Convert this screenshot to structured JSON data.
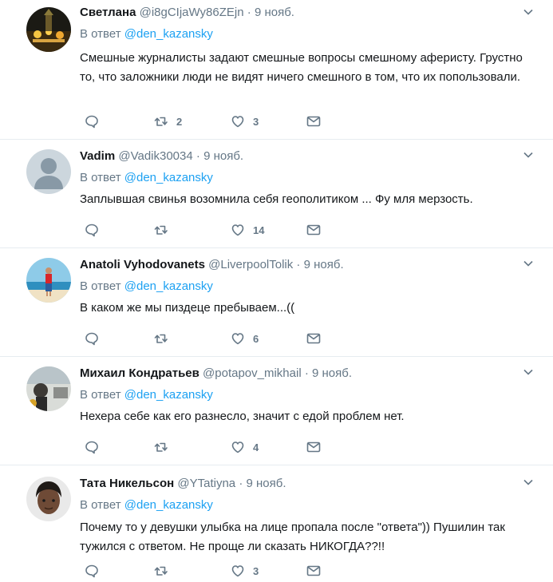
{
  "reply_prefix": "В ответ",
  "tweets": [
    {
      "name": "Светлана",
      "handle": "@i8gCIjaWy86ZEjn",
      "dot": "·",
      "time": "9 нояб.",
      "reply_to": "@den_kazansky",
      "text": "Смешные журналисты задают смешные вопросы смешному аферисту. Грустно то, что заложники люди не видят ничего смешного в том, что их попользовали.",
      "retweets": "2",
      "likes": "3"
    },
    {
      "name": "Vadim",
      "handle": "@Vadik30034",
      "dot": "·",
      "time": "9 нояб.",
      "reply_to": "@den_kazansky",
      "text": "Заплывшая свинья возомнила себя геополитиком ... Фу мля мерзость.",
      "retweets": "",
      "likes": "14"
    },
    {
      "name": "Anatoli Vyhodovanets",
      "handle": "@LiverpoolTolik",
      "dot": "·",
      "time": "9 нояб.",
      "reply_to": "@den_kazansky",
      "text": "В каком же мы пиздеце пребываем...((",
      "retweets": "",
      "likes": "6"
    },
    {
      "name": "Михаил Кондратьев",
      "handle": "@potapov_mikhail",
      "dot": "·",
      "time": "9 нояб.",
      "reply_to": "@den_kazansky",
      "text": "Нехера себе как его разнесло, значит с едой проблем нет.",
      "retweets": "",
      "likes": "4"
    },
    {
      "name": "Тата Никельсон",
      "handle": "@YTatiyna",
      "dot": "·",
      "time": "9 нояб.",
      "reply_to": "@den_kazansky",
      "text": "Почему то у девушки улыбка на лице пропала после \"ответа\")) Пушилин так тужился с ответом. Не проще ли сказать НИКОГДА??!!",
      "retweets": "",
      "likes": "3"
    }
  ]
}
